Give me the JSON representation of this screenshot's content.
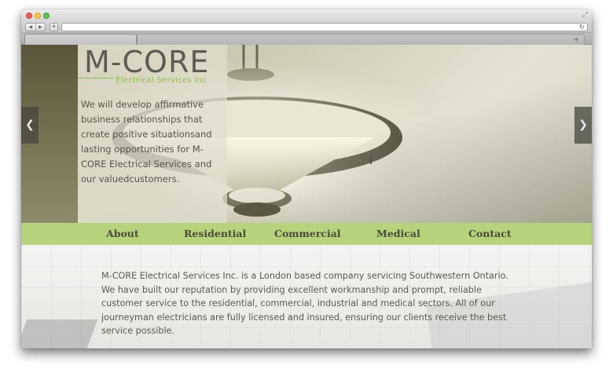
{
  "browser": {
    "icons": {
      "close": "red-close-icon",
      "minimize": "yellow-minimize-icon",
      "zoom": "green-zoom-icon",
      "fullscreen": "fullscreen-icon",
      "back": "back-arrow-icon",
      "forward": "forward-arrow-icon",
      "new_tab": "plus-icon",
      "reload": "reload-icon",
      "add_tab": "plus-icon"
    },
    "glyphs": {
      "fullscreen": "⤢",
      "back": "◀",
      "forward": "▶",
      "new_tab": "+",
      "reload": "↻",
      "add_tab": "+"
    }
  },
  "site": {
    "logo": {
      "mark": "M-CORE",
      "tagline": "Electrical Services Inc"
    },
    "hero": {
      "text": "We will develop affirmative business relationships that create positive situationsand lasting opportunities for M-CORE Electrical Services and our valuedcustomers.",
      "prev_glyph": "❮",
      "next_glyph": "❯"
    },
    "nav": {
      "items": [
        {
          "label": "About"
        },
        {
          "label": "Residential"
        },
        {
          "label": "Commercial"
        },
        {
          "label": "Medical"
        },
        {
          "label": "Contact"
        }
      ]
    },
    "intro": "M-CORE Electrical Services Inc. is a London based company servicing Southwestern Ontario. We have built our reputation by providing excellent workmanship and prompt, reliable customer service to the residential, commercial, industrial and medical sectors. All of our journeyman electricians are fully licensed and insured, ensuring our clients receive the best service possible."
  },
  "colors": {
    "accent_green": "#b5d37a",
    "logo_green": "#8dc04c",
    "text": "#5a5a50"
  }
}
